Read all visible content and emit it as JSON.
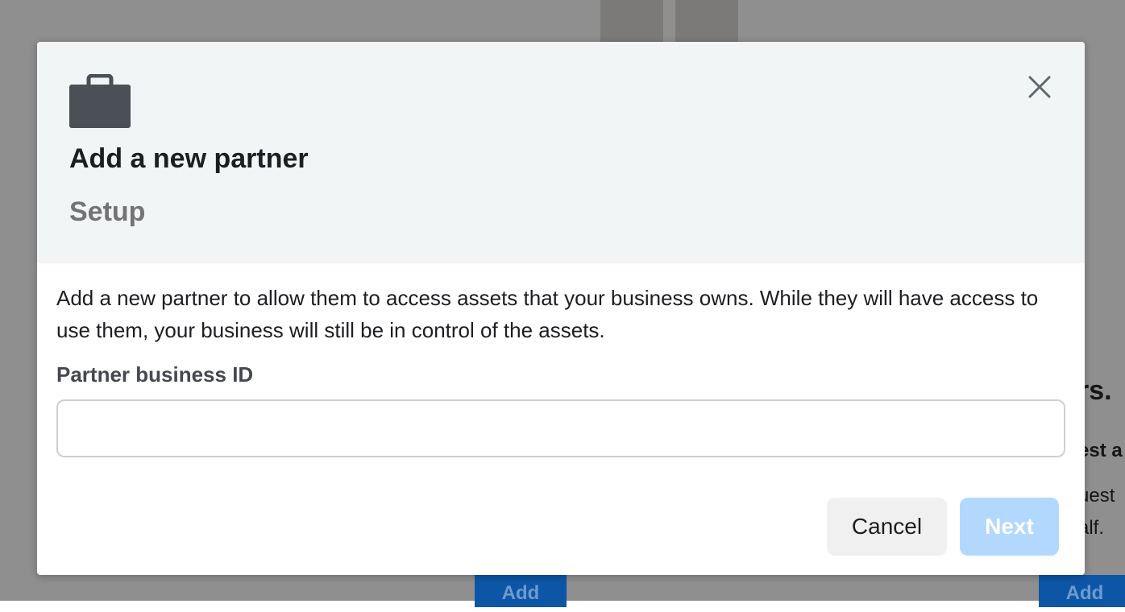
{
  "background": {
    "heading_fragment": "rs.",
    "subheading_fragment": "est a",
    "paragraph_line1_fragment": "uest",
    "paragraph_line2_fragment": "alf.",
    "add_button_1_label": "Add",
    "add_button_2_label": "Add"
  },
  "modal": {
    "icon": "briefcase-icon",
    "close_icon": "close-icon",
    "title": "Add a new partner",
    "subtitle": "Setup",
    "description": "Add a new partner to allow them to access assets that your business owns. While they will have access to use them, your business will still be in control of the assets.",
    "field_label": "Partner business ID",
    "field_value": "",
    "field_placeholder": "",
    "cancel_label": "Cancel",
    "next_label": "Next",
    "next_disabled": true
  },
  "colors": {
    "overlay": "#8f8f8f",
    "header_bg": "#f2f5f6",
    "primary_disabled": "#b3d8fd",
    "primary_bg_button": "#0d56a6"
  }
}
